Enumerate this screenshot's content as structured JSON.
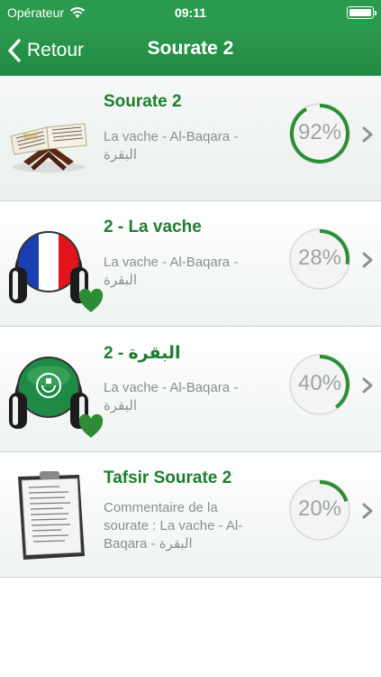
{
  "status_bar": {
    "carrier": "Opérateur",
    "time": "09:11"
  },
  "nav": {
    "back_label": "Retour",
    "title": "Sourate 2"
  },
  "items": [
    {
      "title": "Sourate 2",
      "subtitle_line1": "La vache - Al-Baqara -",
      "subtitle_line2": "البقرة",
      "subtitle_line3": "",
      "progress_label": "92%",
      "progress": 0.92,
      "icon": "quran-on-stand-icon",
      "favorite": false
    },
    {
      "title": "2 - La vache",
      "subtitle_line1": "La vache - Al-Baqara -",
      "subtitle_line2": "البقرة",
      "subtitle_line3": "",
      "progress_label": "28%",
      "progress": 0.28,
      "icon": "headphones-french-flag-icon",
      "favorite": true
    },
    {
      "title": "2 - البقرة",
      "subtitle_line1": "La vache - Al-Baqara -",
      "subtitle_line2": "البقرة",
      "subtitle_line3": "",
      "progress_label": "40%",
      "progress": 0.4,
      "icon": "headphones-arab-flag-icon",
      "favorite": true
    },
    {
      "title": "Tafsir Sourate 2",
      "subtitle_line1": "Commentaire de la",
      "subtitle_line2": "sourate : La vache - Al-",
      "subtitle_line3": "Baqara - البقرة",
      "progress_label": "20%",
      "progress": 0.2,
      "icon": "clipboard-document-icon",
      "favorite": false
    }
  ],
  "colors": {
    "bar_green": "#2c9a4e",
    "title_green": "#1f7d31",
    "progress_green": "#2a8f34",
    "heart_green": "#2e8b36"
  }
}
